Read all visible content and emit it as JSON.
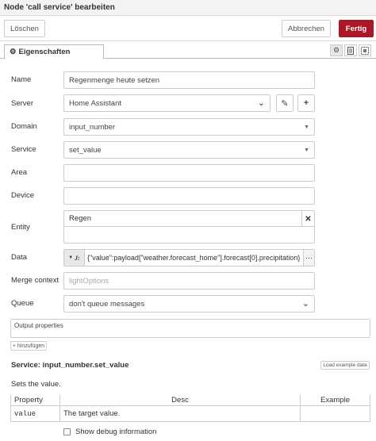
{
  "window": {
    "title": "Node 'call service' bearbeiten"
  },
  "toolbar": {
    "delete_label": "Löschen",
    "cancel_label": "Abbrechen",
    "done_label": "Fertig"
  },
  "tabs": {
    "properties_label": "Eigenschaften"
  },
  "form": {
    "name": {
      "label": "Name",
      "value": "Regenmenge heute setzen"
    },
    "server": {
      "label": "Server",
      "value": "Home Assistant"
    },
    "domain": {
      "label": "Domain",
      "value": "input_number"
    },
    "service": {
      "label": "Service",
      "value": "set_value"
    },
    "area": {
      "label": "Area",
      "value": ""
    },
    "device": {
      "label": "Device",
      "value": ""
    },
    "entity": {
      "label": "Entity",
      "value": "Regen"
    },
    "data": {
      "label": "Data",
      "value": "{\"value\":payload[\"weather.forecast_home\"].forecast[0].precipitation}"
    },
    "merge_context": {
      "label": "Merge context",
      "placeholder": "lightOptions"
    },
    "queue": {
      "label": "Queue",
      "value": "don't queue messages"
    }
  },
  "output": {
    "label": "Output properties",
    "add_label": "+ hinzufügen"
  },
  "service_info": {
    "title": "Service: input_number.set_value",
    "load_label": "Load example data",
    "description": "Sets the value.",
    "columns": [
      "Property",
      "Desc",
      "Example"
    ],
    "rows": [
      {
        "property": "value",
        "desc": "The target value.",
        "example": ""
      }
    ]
  },
  "debug": {
    "label": "Show debug information"
  }
}
